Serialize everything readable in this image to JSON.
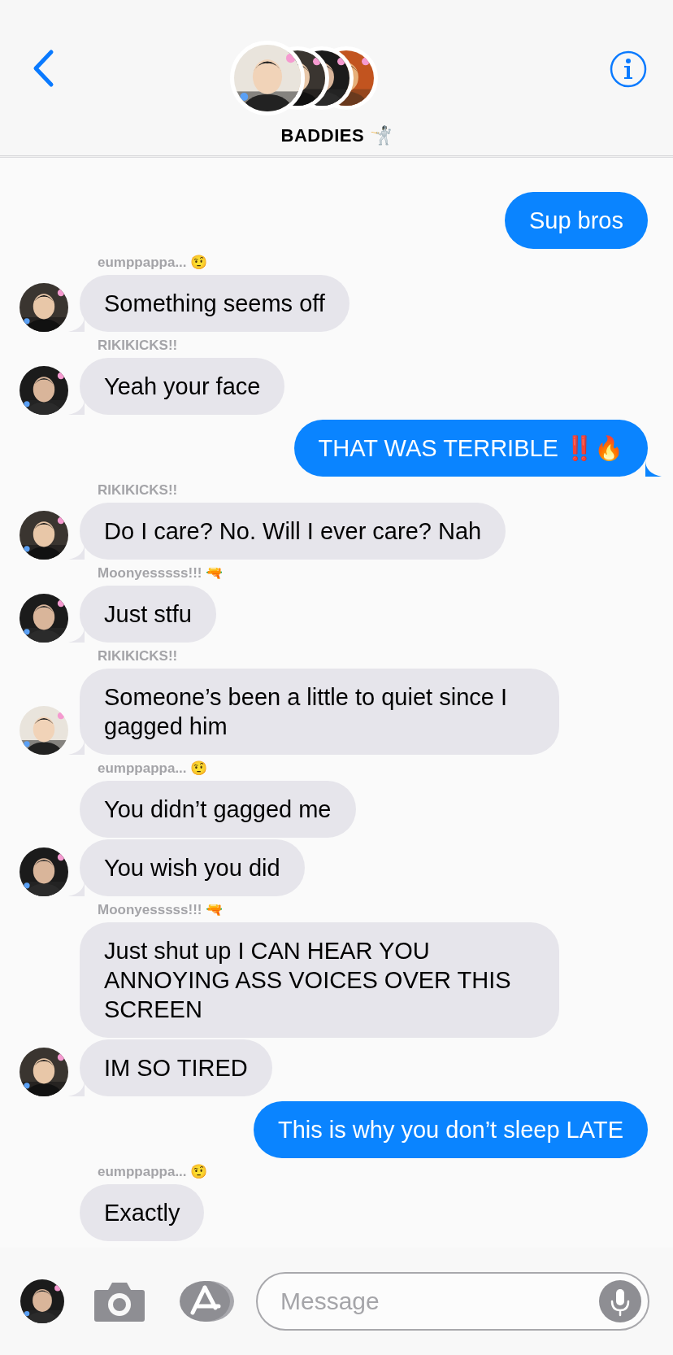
{
  "header": {
    "title": "BADDIES 🤺"
  },
  "messages": [
    {
      "kind": "sent",
      "text": "Sup bros",
      "tail": false
    },
    {
      "kind": "received",
      "sender": "eumppappa... 🤨",
      "text": "Something seems off",
      "avatar": true
    },
    {
      "kind": "received",
      "sender": "RIKIKICKS!!",
      "text": "Yeah your face",
      "avatar": true
    },
    {
      "kind": "sent",
      "text": "THAT WAS TERRIBLE ‼️🔥",
      "tail": true
    },
    {
      "kind": "received",
      "sender": "RIKIKICKS!!",
      "text": "Do I care? No. Will I ever care? Nah",
      "avatar": true
    },
    {
      "kind": "received",
      "sender": "Moonyesssss!!! 🔫",
      "text": "Just stfu",
      "avatar": true
    },
    {
      "kind": "received",
      "sender": "RIKIKICKS!!",
      "text": "Someone’s been a little to quiet since I gagged him",
      "avatar": true
    },
    {
      "kind": "received",
      "sender": "eumppappa... 🤨",
      "text": "You didn’t gagged me",
      "avatar": false
    },
    {
      "kind": "received",
      "text": "You wish you did",
      "avatar": true
    },
    {
      "kind": "received",
      "sender": "Moonyesssss!!! 🔫",
      "text": "Just shut up I CAN HEAR YOU ANNOYING ASS VOICES OVER THIS SCREEN",
      "avatar": false
    },
    {
      "kind": "received",
      "text": "IM SO TIRED",
      "avatar": true
    },
    {
      "kind": "sent",
      "text": "This is why you don’t sleep LATE",
      "tail": false
    },
    {
      "kind": "received",
      "sender": "eumppappa... 🤨",
      "text": "Exactly",
      "avatar": false
    }
  ],
  "composer": {
    "placeholder": "Message"
  }
}
